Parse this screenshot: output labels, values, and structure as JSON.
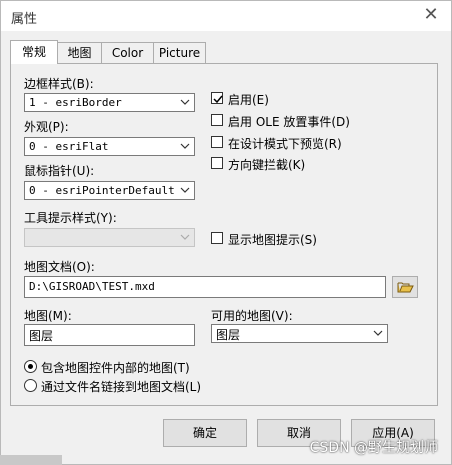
{
  "window": {
    "title": "属性",
    "close_symbol": "✕"
  },
  "tabs": [
    {
      "label": "常规",
      "active": true
    },
    {
      "label": "地图",
      "active": false
    },
    {
      "label": "Color",
      "active": false
    },
    {
      "label": "Picture",
      "active": false
    }
  ],
  "general": {
    "border_style": {
      "label": "边框样式(B):",
      "value": "1 - esriBorder"
    },
    "appearance": {
      "label": "外观(P):",
      "value": "0 - esriFlat"
    },
    "mouse_pointer": {
      "label": "鼠标指针(U):",
      "value": "0 - esriPointerDefault"
    },
    "tooltip_style": {
      "label": "工具提示样式(Y):",
      "value": ""
    },
    "checkboxes": [
      {
        "label": "启用(E)",
        "checked": true
      },
      {
        "label": "启用 OLE 放置事件(D)",
        "checked": false
      },
      {
        "label": "在设计模式下预览(R)",
        "checked": false
      },
      {
        "label": "方向键拦截(K)",
        "checked": false
      }
    ],
    "show_map_tips": {
      "label": "显示地图提示(S)",
      "checked": false
    },
    "map_document": {
      "label": "地图文档(O):",
      "value": "D:\\GISROAD\\TEST.mxd"
    },
    "map": {
      "label": "地图(M):",
      "value": "图层"
    },
    "available_maps": {
      "label": "可用的地图(V):",
      "value": "图层"
    },
    "radios": [
      {
        "label": "包含地图控件内部的地图(T)",
        "selected": true
      },
      {
        "label": "通过文件名链接到地图文档(L)",
        "selected": false
      }
    ]
  },
  "buttons": {
    "ok": "确定",
    "cancel": "取消",
    "apply": "应用(A)"
  },
  "watermark": "CSDN @野生规划师"
}
